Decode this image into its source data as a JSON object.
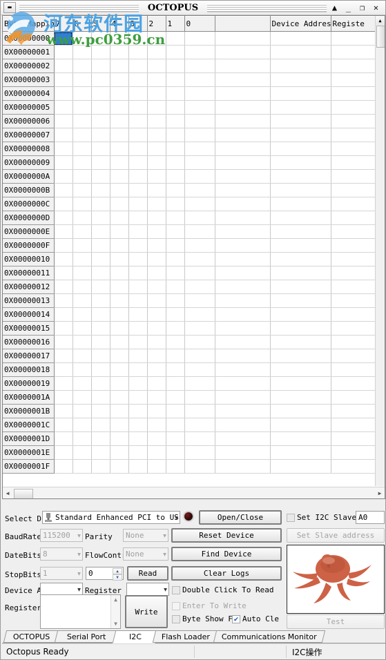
{
  "window": {
    "title": "OCTOPUS",
    "sys_menu_icon": "window-menu-icon",
    "controls": [
      {
        "name": "rollup-button",
        "glyph": "▲"
      },
      {
        "name": "minimize-button",
        "glyph": "_"
      },
      {
        "name": "maximize-button",
        "glyph": "❐"
      },
      {
        "name": "close-button",
        "glyph": "✕"
      }
    ]
  },
  "watermark": {
    "cn_text": "河东软件园",
    "url_text": "www.pc0359.cn",
    "cn_color": "#4ba3e3",
    "url_color": "#3f9e3f"
  },
  "grid": {
    "columns": [
      "Byte Mapping",
      "7",
      "6",
      "5",
      "4",
      "3",
      "2",
      "1",
      "0",
      "",
      "Device Addres",
      "Registe"
    ],
    "rows": [
      "0X00000000",
      "0X00000001",
      "0X00000002",
      "0X00000003",
      "0X00000004",
      "0X00000005",
      "0X00000006",
      "0X00000007",
      "0X00000008",
      "0X00000009",
      "0X0000000A",
      "0X0000000B",
      "0X0000000C",
      "0X0000000D",
      "0X0000000E",
      "0X0000000F",
      "0X00000010",
      "0X00000011",
      "0X00000012",
      "0X00000013",
      "0X00000014",
      "0X00000015",
      "0X00000016",
      "0X00000017",
      "0X00000018",
      "0X00000019",
      "0X0000001A",
      "0X0000001B",
      "0X0000001C",
      "0X0000001D",
      "0X0000001E",
      "0X0000001F"
    ],
    "selected_cell": {
      "row": 0,
      "col": 0
    },
    "selection_color": "#2f7fd4"
  },
  "panel": {
    "select_device_label": "Select D",
    "device_combo_value": "Standard Enhanced PCI to US",
    "device_combo_icon": "usb-plug-icon",
    "led_name": "connection-led",
    "baudrate_label": "BaudRate",
    "baudrate_value": "115200",
    "databits_label": "DateBits",
    "databits_value": "8",
    "stopbits_label": "StopBits",
    "stopbits_value": "1",
    "parity_label": "Parity",
    "parity_value": "None",
    "flowcontrol_label": "FlowContro",
    "flowcontrol_value": "None",
    "spinner_value": "0",
    "read_button": "Read",
    "device_address_label": "Device A",
    "device_address_value": "",
    "register_address_label": "Register A",
    "register_address_value": "",
    "register_label": "Register",
    "register_text": "",
    "write_button": "Write",
    "open_close_button": "Open/Close",
    "reset_device_button": "Reset Device",
    "find_device_button": "Find Device",
    "clear_logs_button": "Clear Logs",
    "set_i2c_slave_label": "Set I2C Slave",
    "set_i2c_slave_checked": false,
    "slave_address_value": "A0",
    "set_slave_address_button": "Set Slave address",
    "double_click_to_read_label": "Double Click To Read",
    "double_click_to_read_checked": false,
    "enter_to_write_label": "Enter To Write",
    "enter_to_write_checked": false,
    "byte_show_label": "Byte Show Fo",
    "byte_show_checked": false,
    "auto_clear_label": "Auto Cle",
    "auto_clear_checked": true,
    "test_button": "Test",
    "image_name": "octopus-photo"
  },
  "tabs": [
    {
      "label": "OCTOPUS",
      "active": false
    },
    {
      "label": "Serial Port",
      "active": false
    },
    {
      "label": "I2C",
      "active": true
    },
    {
      "label": "Flash Loader",
      "active": false
    },
    {
      "label": "Communications Monitor",
      "active": false
    }
  ],
  "statusbar": {
    "left": "Octopus Ready",
    "right": "I2C操作"
  }
}
